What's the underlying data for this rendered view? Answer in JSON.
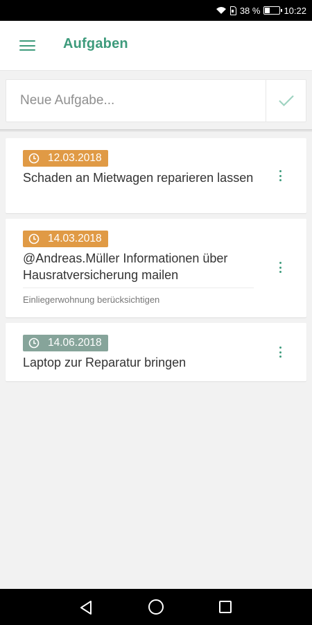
{
  "status_bar": {
    "battery": "38 %",
    "time": "10:22"
  },
  "app_bar": {
    "title": "Aufgaben",
    "menu_icon": "hamburger-menu-icon"
  },
  "new_task": {
    "placeholder": "Neue Aufgabe...",
    "value": "",
    "confirm_icon": "check-icon"
  },
  "colors": {
    "accent": "#3e9b7c",
    "badge_orange": "#e09a45",
    "badge_gray": "#86a49a"
  },
  "tasks": [
    {
      "date": "12.03.2018",
      "title": "Schaden an Mietwagen reparieren lassen",
      "note": "",
      "badge_color": "orange"
    },
    {
      "date": "14.03.2018",
      "title": "@Andreas.Müller Informationen über Hausratversicherung mailen",
      "note": "Einliegerwohnung berücksichtigen",
      "badge_color": "orange"
    },
    {
      "date": "14.06.2018",
      "title": "Laptop zur Reparatur bringen",
      "note": "",
      "badge_color": "gray"
    }
  ],
  "nav_bar": {
    "icons": [
      "back-icon",
      "home-icon",
      "recents-icon"
    ]
  }
}
